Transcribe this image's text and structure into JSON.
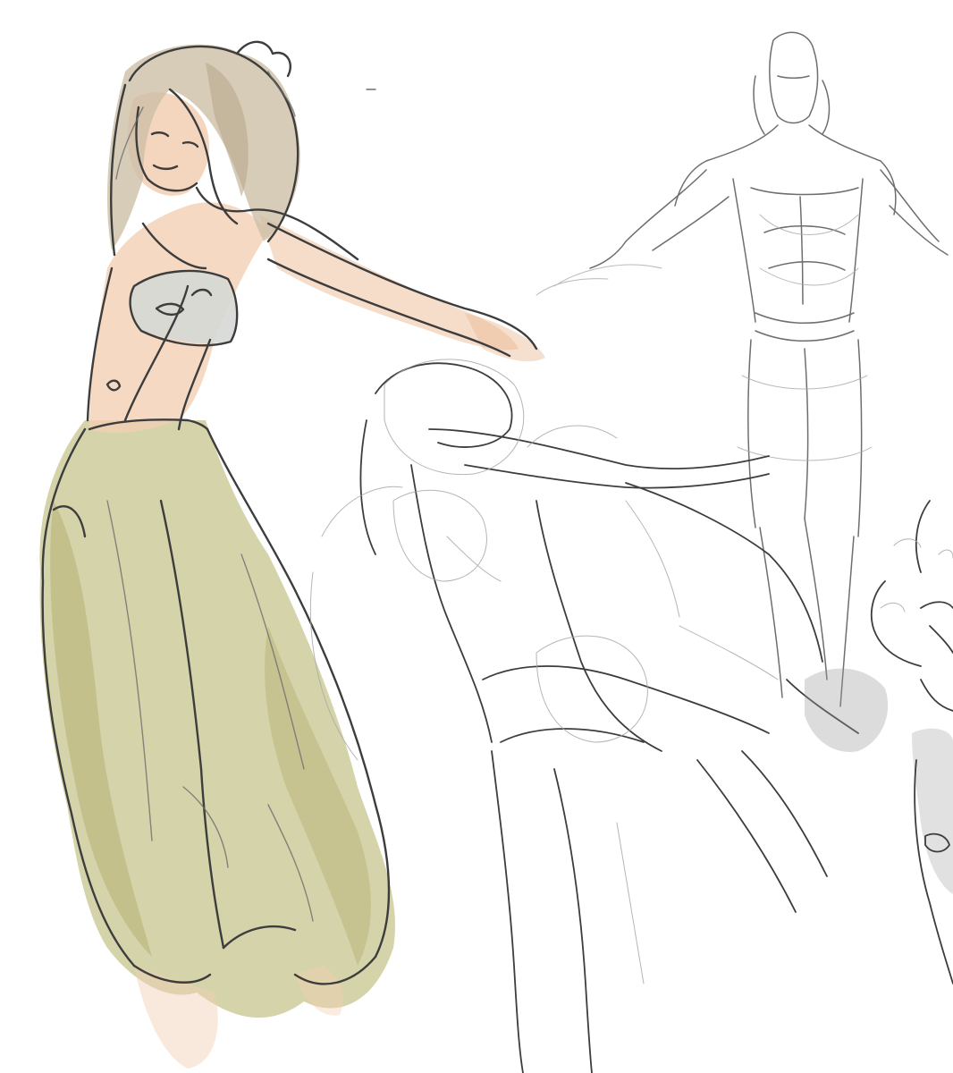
{
  "canvas": {
    "background": "#ffffff"
  },
  "palette": {
    "ink_dark": "#3d3d3d",
    "ink_mid": "#6e6e6e",
    "ink_light": "#a9a9a9",
    "skin": "#f2cfb4",
    "skin_shadow": "#e8b892",
    "hair": "#cdbfa6",
    "hair_shadow": "#b9a88c",
    "skirt": "#c7c48c",
    "skirt_shadow": "#b2ad6f",
    "top": "#d6d8d6",
    "grey_wash": "#9a9a9a"
  },
  "figures": [
    {
      "name": "colored-dancer",
      "rendering": "watercolor"
    },
    {
      "name": "standing-male-sketch",
      "rendering": "pencil"
    },
    {
      "name": "bending-figure-sketch",
      "rendering": "pencil"
    },
    {
      "name": "curly-hair-figure-sketch",
      "rendering": "pencil-grey-wash"
    }
  ]
}
